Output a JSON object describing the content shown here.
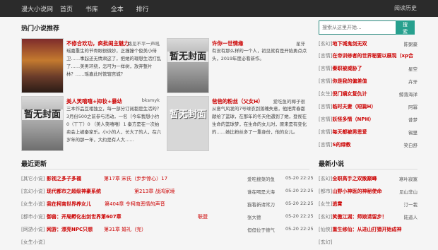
{
  "topbar": {
    "logo": "漫大小说网",
    "nav": [
      "首页",
      "书库",
      "全本",
      "排行"
    ],
    "history": "阅读历史"
  },
  "hot": {
    "title": "热门小说推荐",
    "cards": [
      {
        "title": "不修合欢功，疯批闺主魅力",
        "author": "路见不平一声吼",
        "desc": "瑶嘉重生的节骨眼很微妙，正撞撞个俊美小侍卫……事起还无情肃这了，把她的理想生活打乱了……美男环绕，怎可为一样树，放弃整片林？……瑶嘉此时管辖宫城？",
        "cover": "cover-a",
        "cover_text": ""
      },
      {
        "title": "许你一世情缘",
        "author": "星牙",
        "desc": "有没有那么样的一个人，初见就有是开始勇点点头，2019年度必看新作。",
        "cover": "cover-b",
        "cover_text": "暂无封面"
      },
      {
        "title": "美人笑嘻嘻+抑妆+暴幼",
        "author": "bksmyk",
        "desc": "三本作品互相独立，每一部分订阅都是生活的？ 3月份500之前参与活动，一名（今年我想小约0（ㄒㄒ）0 （美人笑嘻嘻）1 秦方是在一次拍卖会上被秦家乐。小小的人，长大了的人，在六岁年的那一年，大约是有人大……",
        "cover": "cover-b",
        "cover_text": "暂无封面"
      },
      {
        "title": "爸爸的粉丝（父女H）",
        "author": "爱吃鱼的椰子很",
        "desc": "从意气风发的7号球衣到落魄失意，他把青春都献给了篮球，在那年的冬天他遇到了她，登视在生命的篮球梦，在生命的女儿时，原来是有变化的……她比粉丝多了一重身份，他的女儿。",
        "cover": "cover-c",
        "cover_text": "暂无封面"
      }
    ]
  },
  "search": {
    "placeholder": "搜索从这里开始...",
    "button": "搜 索"
  },
  "side_hot": [
    {
      "cat": "[玄幻]",
      "title": "地下城鬼剑无双",
      "author": "陈弼豪"
    },
    {
      "cat": "[言情]",
      "title": "在帝训修者的世界秘要以展现（xp合",
      "author": ""
    },
    {
      "cat": "[言情]",
      "title": "秦职被威胁了",
      "author": "星空"
    },
    {
      "cat": "[言情]",
      "title": "你是我的偏差值",
      "author": "卉牙"
    },
    {
      "cat": "[女生]",
      "title": "倪门嫡女复仇计",
      "author": "鲸落海洋"
    },
    {
      "cat": "[言情]",
      "title": "临时夫妻（短篇H）",
      "author": "阿幂"
    },
    {
      "cat": "[言情]",
      "title": "妖怪多情（NPH）",
      "author": "昔梦"
    },
    {
      "cat": "[言情]",
      "title": "每天都被男恩爱",
      "author": "锡里"
    },
    {
      "cat": "[言情]",
      "title": "S的绿教",
      "author": "笑白舒"
    }
  ],
  "updates": {
    "title": "最近更新",
    "rows": [
      {
        "cat": "[其它小说]",
        "title": "影视之多子多福",
        "chapter": "第17章 宋氏（步步惊心）17",
        "author": "爱吃搜菜的鱼",
        "date": "05-20 22:25"
      },
      {
        "cat": "[玄幻小说]",
        "title": "现代都市之超级神豪系统",
        "chapter": "第213章 战鸿家境",
        "author": "谁在喝是大海",
        "date": "05-20 22:25"
      },
      {
        "cat": "[女生小说]",
        "title": "我在柯南世界养女儿",
        "chapter": "第404章 令柯南恶情的声音",
        "author": "猫看新请常刀",
        "date": "05-20 22:25"
      },
      {
        "cat": "[都市小说]",
        "title": "御兽：开局孵化出剑世界第607章",
        "chapter": "联盟",
        "author": "张大德",
        "date": "05-20 22:25"
      },
      {
        "cat": "[网游小说]",
        "title": "网游：漂亮NPC只想",
        "chapter": "第31章 婚礼（完）",
        "author": "但但位于德气",
        "date": "05-20 22:25"
      },
      {
        "cat": "[女生小说]",
        "title": "",
        "chapter": "",
        "author": "",
        "date": ""
      }
    ]
  },
  "newest": {
    "title": "最新小说",
    "rows": [
      {
        "cat": "[玄幻]",
        "title": "全职高手之双散巅峰",
        "author": "寒叶寂寞"
      },
      {
        "cat": "[都市]",
        "title": "山野小神医的神秘使命",
        "author": "见山非山"
      },
      {
        "cat": "[女生]",
        "title": "逃霄",
        "author": "汀一栽"
      },
      {
        "cat": "[玄幻]",
        "title": "笑傲江湖：师娘请留步！",
        "author": "陆道人"
      },
      {
        "cat": "[仙侠]",
        "title": "重生修仙：从进山打猎开始成神",
        "author": ""
      },
      {
        "cat": "[玄幻]",
        "title": "",
        "author": ""
      }
    ]
  }
}
